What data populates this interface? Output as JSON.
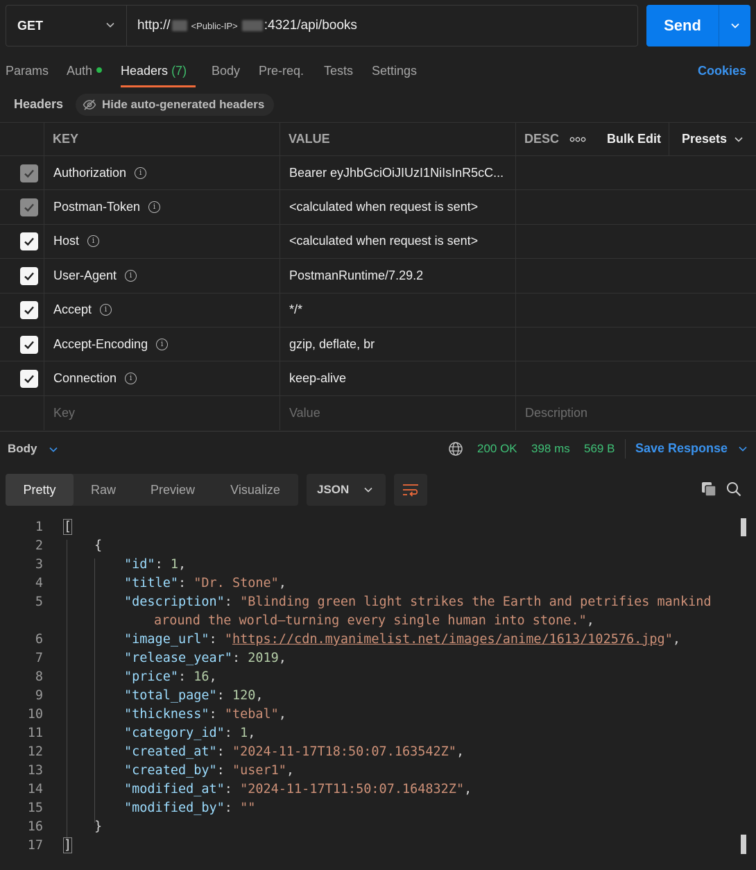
{
  "request": {
    "method": "GET",
    "url_prefix": "http://",
    "url_ip_placeholder": "<Public-IP>",
    "url_suffix": ":4321/api/books",
    "send_label": "Send"
  },
  "request_tabs": {
    "params": "Params",
    "auth": "Auth",
    "headers": "Headers",
    "headers_count": "(7)",
    "body": "Body",
    "prereq": "Pre-req.",
    "tests": "Tests",
    "settings": "Settings",
    "cookies": "Cookies"
  },
  "headers_section": {
    "label": "Headers",
    "hide_auto": "Hide auto-generated headers"
  },
  "headers_table": {
    "col_key": "KEY",
    "col_value": "VALUE",
    "col_desc": "DESC",
    "more": "ooo",
    "bulk_edit": "Bulk Edit",
    "presets": "Presets",
    "rows": [
      {
        "key": "Authorization",
        "value": "Bearer eyJhbGciOiJIUzI1NiIsInR5cC..."
      },
      {
        "key": "Postman-Token",
        "value": "<calculated when request is sent>"
      },
      {
        "key": "Host",
        "value": "<calculated when request is sent>"
      },
      {
        "key": "User-Agent",
        "value": "PostmanRuntime/7.29.2"
      },
      {
        "key": "Accept",
        "value": "*/*"
      },
      {
        "key": "Accept-Encoding",
        "value": "gzip, deflate, br"
      },
      {
        "key": "Connection",
        "value": "keep-alive"
      }
    ],
    "placeholder_key": "Key",
    "placeholder_value": "Value",
    "placeholder_desc": "Description"
  },
  "response": {
    "body_label": "Body",
    "status": "200 OK",
    "time": "398 ms",
    "size": "569 B",
    "save_response": "Save Response",
    "view_tabs": [
      "Pretty",
      "Raw",
      "Preview",
      "Visualize"
    ],
    "format": "JSON"
  },
  "code": {
    "line_numbers": [
      "1",
      "2",
      "3",
      "4",
      "5",
      "",
      "6",
      "7",
      "8",
      "9",
      "10",
      "11",
      "12",
      "13",
      "14",
      "15",
      "16",
      "17"
    ],
    "open_bracket": "[",
    "open_brace": "{",
    "close_brace": "}",
    "close_bracket": "]",
    "fields": [
      {
        "key": "\"id\"",
        "value": "1",
        "type": "n"
      },
      {
        "key": "\"title\"",
        "value": "\"Dr. Stone\"",
        "type": "s"
      },
      {
        "key": "\"description\"",
        "value": "\"Blinding green light strikes the Earth and petrifies mankind",
        "type": "s"
      },
      {
        "key": "",
        "value": "around the world—turning every single human into stone.\"",
        "type": "s"
      },
      {
        "key": "\"image_url\"",
        "value": "https://cdn.myanimelist.net/images/anime/1613/102576.jpg",
        "type": "u"
      },
      {
        "key": "\"release_year\"",
        "value": "2019",
        "type": "n"
      },
      {
        "key": "\"price\"",
        "value": "16",
        "type": "n"
      },
      {
        "key": "\"total_page\"",
        "value": "120",
        "type": "n"
      },
      {
        "key": "\"thickness\"",
        "value": "\"tebal\"",
        "type": "s"
      },
      {
        "key": "\"category_id\"",
        "value": "1",
        "type": "n"
      },
      {
        "key": "\"created_at\"",
        "value": "\"2024-11-17T18:50:07.163542Z\"",
        "type": "s"
      },
      {
        "key": "\"created_by\"",
        "value": "\"user1\"",
        "type": "s"
      },
      {
        "key": "\"modified_at\"",
        "value": "\"2024-11-17T11:50:07.164832Z\"",
        "type": "s"
      },
      {
        "key": "\"modified_by\"",
        "value": "\"\"",
        "type": "s"
      }
    ]
  }
}
